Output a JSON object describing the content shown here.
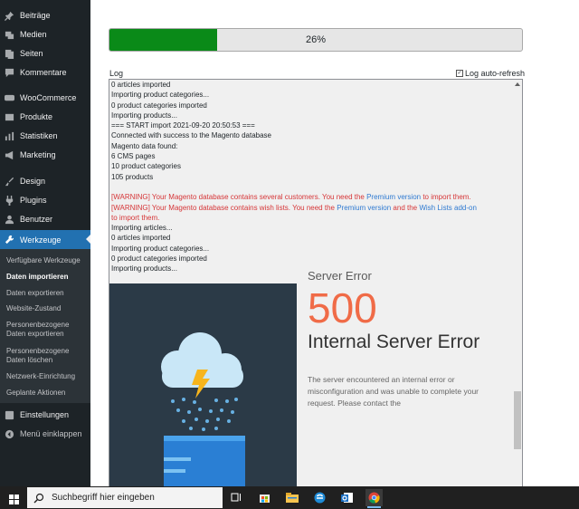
{
  "sidebar": {
    "items": [
      {
        "label": "Beiträge",
        "icon": "pin-icon"
      },
      {
        "label": "Medien",
        "icon": "media-icon"
      },
      {
        "label": "Seiten",
        "icon": "page-icon"
      },
      {
        "label": "Kommentare",
        "icon": "comment-icon"
      },
      {
        "label": "WooCommerce",
        "icon": "woo-icon"
      },
      {
        "label": "Produkte",
        "icon": "box-icon"
      },
      {
        "label": "Statistiken",
        "icon": "chart-icon"
      },
      {
        "label": "Marketing",
        "icon": "megaphone-icon"
      },
      {
        "label": "Design",
        "icon": "brush-icon"
      },
      {
        "label": "Plugins",
        "icon": "plug-icon"
      },
      {
        "label": "Benutzer",
        "icon": "user-icon"
      },
      {
        "label": "Werkzeuge",
        "icon": "wrench-icon"
      },
      {
        "label": "Einstellungen",
        "icon": "settings-icon"
      },
      {
        "label": "Menü einklappen",
        "icon": "collapse-icon"
      }
    ],
    "submenu": [
      "Verfügbare Werkzeuge",
      "Daten importieren",
      "Daten exportieren",
      "Website-Zustand",
      "Personenbezogene Daten exportieren",
      "Personenbezogene Daten löschen",
      "Netzwerk-Einrichtung",
      "Geplante Aktionen"
    ]
  },
  "progress": {
    "percent": 26,
    "label": "26%",
    "color": "#0a8a18"
  },
  "log": {
    "label": "Log",
    "autorefresh_label": "Log auto-refresh",
    "autorefresh_checked": true,
    "lines_top": [
      "0 articles imported",
      "Importing product categories...",
      "0 product categories imported",
      "Importing products...",
      "=== START import 2021-09-20 20:50:53 ===",
      "Connected with success to the Magento database",
      "Magento data found:",
      "6 CMS pages",
      "10 product categories",
      "105 products",
      ""
    ],
    "warning1": {
      "text": "[WARNING] Your Magento database contains several customers. You need the ",
      "link": "Premium version",
      "after": " to import them."
    },
    "warning2": {
      "text": "[WARNING] Your Magento database contains wish lists. You need the ",
      "link1": "Premium version",
      "mid": " and the ",
      "link2": "Wish Lists add-on",
      "line2": "to import them."
    },
    "lines_bottom": [
      "Importing articles...",
      "0 articles imported",
      "Importing product categories...",
      "0 product categories imported",
      "Importing products..."
    ]
  },
  "error_page": {
    "title": "Server Error",
    "code": "500",
    "message": "Internal Server Error",
    "description": "The server encountered an internal error or misconfiguration and was unable to complete your request. Please contact the"
  },
  "taskbar": {
    "search_placeholder": "Suchbegriff hier eingeben"
  },
  "colors": {
    "sidebar": "#1d2327",
    "active": "#2271b1",
    "warning": "#d63638",
    "link": "#2f7ad1",
    "error_code": "#f06b47"
  }
}
